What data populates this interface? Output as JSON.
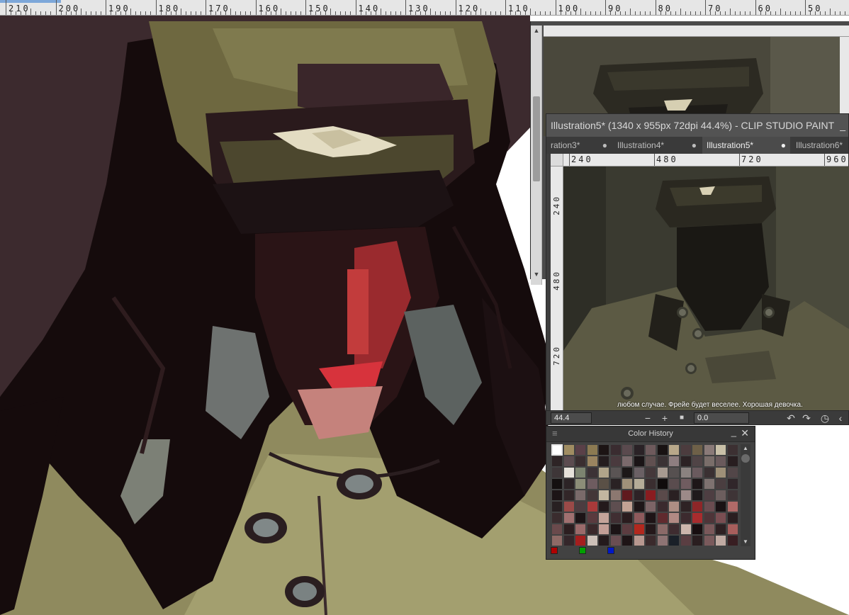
{
  "top_ruler": {
    "labels": [
      "210",
      "200",
      "190",
      "180",
      "170",
      "160",
      "150",
      "140",
      "130",
      "120",
      "110",
      "100",
      "90",
      "80",
      "70",
      "60",
      "50"
    ]
  },
  "navigator": {
    "scroll_up": "▲",
    "scroll_down": "▼"
  },
  "illustration_window": {
    "title": "Illustration5* (1340 x 955px 72dpi 44.4%)  - CLIP STUDIO PAINT",
    "minimize": "_",
    "tabs": [
      {
        "label": "ration3*",
        "active": false
      },
      {
        "label": "Illustration4*",
        "active": false
      },
      {
        "label": "Illustration5*",
        "active": true
      },
      {
        "label": "Illustration6*",
        "active": false
      }
    ],
    "tab_dot": "●",
    "ruler_top_labels": [
      "240",
      "480",
      "720",
      "960"
    ],
    "ruler_left_labels": [
      "240",
      "480",
      "720"
    ],
    "subtitle": "любом случае. Фрейе будет веселее. Хорошая девочка.",
    "status": {
      "zoom": "44.4",
      "zoom_out": "−",
      "zoom_in": "+",
      "stop": "■",
      "angle": "0.0",
      "undo": "↶",
      "redo": "↷",
      "rotate": "◷",
      "collapse": "‹"
    }
  },
  "color_history": {
    "title": "Color History",
    "menu": "≡",
    "minimize": "_",
    "close": "✕",
    "scroll_up": "▲",
    "scroll_down": "▼",
    "accent_colors": [
      "#b00000",
      "#00a000",
      "#0018c8"
    ],
    "swatches": [
      "#ffffff",
      "#a08d62",
      "#5a4048",
      "#8c7a52",
      "#1c1414",
      "#3a2c30",
      "#5a4a4e",
      "#2a2226",
      "#6e5a5c",
      "#181212",
      "#b8a88a",
      "#4c3c3e",
      "#6e6048",
      "#8a7a78",
      "#c9c0a8",
      "#3c3032",
      "#2e2426",
      "#5c4c50",
      "#3a2e30",
      "#9a8460",
      "#241c1e",
      "#4a3a3e",
      "#7a6a6c",
      "#1a1416",
      "#605050",
      "#3a3234",
      "#8e7e80",
      "#2c2224",
      "#504446",
      "#7a6e6a",
      "#6a5a5c",
      "#281e20",
      "#3e3638",
      "#e6e2da",
      "#7c8470",
      "#3c3236",
      "#b0a48a",
      "#5a5454",
      "#1c1818",
      "#6a6064",
      "#44383a",
      "#a69a90",
      "#565050",
      "#8a8280",
      "#6a5a5e",
      "#3a3032",
      "#9e9078",
      "#524648",
      "#141010",
      "#2c2426",
      "#8c8e78",
      "#6e5c60",
      "#5a5046",
      "#2a2224",
      "#a0927a",
      "#b4ac98",
      "#3a2e30",
      "#100c0c",
      "#5a4c4e",
      "#705c60",
      "#1e1618",
      "#7e7270",
      "#4a3e40",
      "#30262a",
      "#1c1416",
      "#322628",
      "#7a6a6a",
      "#443638",
      "#c2b6a0",
      "#8c7870",
      "#601a1e",
      "#2e2226",
      "#8a1c20",
      "#5a4a4a",
      "#2a2022",
      "#9c8a88",
      "#201a1c",
      "#4e3e42",
      "#6c5e5e",
      "#3e3436",
      "#282022",
      "#9a4a48",
      "#4c3c40",
      "#a83a3a",
      "#241a1c",
      "#5e4e50",
      "#c2a294",
      "#1e1618",
      "#7c6466",
      "#3a2a2e",
      "#ae8e84",
      "#2e2224",
      "#8e2628",
      "#6a4c50",
      "#1a1214",
      "#b06a68",
      "#3a2c2e",
      "#a07070",
      "#1c1416",
      "#5a3a3e",
      "#c4a49a",
      "#402e32",
      "#2a1c1e",
      "#8e5a5c",
      "#1e1416",
      "#602a2e",
      "#b28a84",
      "#3c2a2e",
      "#a82c2e",
      "#4e3438",
      "#7a4e52",
      "#2a1e20",
      "#6a4a4c",
      "#2c1e20",
      "#9a6a6a",
      "#3a282a",
      "#c29e96",
      "#1c1416",
      "#5c3c40",
      "#b2281e",
      "#24181a",
      "#8a6a68",
      "#3e2c30",
      "#ccb6ac",
      "#180e10",
      "#7a585a",
      "#2e2022",
      "#a85e5c",
      "#8e6a66",
      "#34262a",
      "#a41e1e",
      "#ccc0b8",
      "#241a1c",
      "#6a4e52",
      "#1e1416",
      "#b89890",
      "#3a2a2c",
      "#8e7474",
      "#1a2028",
      "#5a3e42",
      "#2a1e20",
      "#7a5a5c",
      "#c0aaa2",
      "#381e22"
    ]
  }
}
